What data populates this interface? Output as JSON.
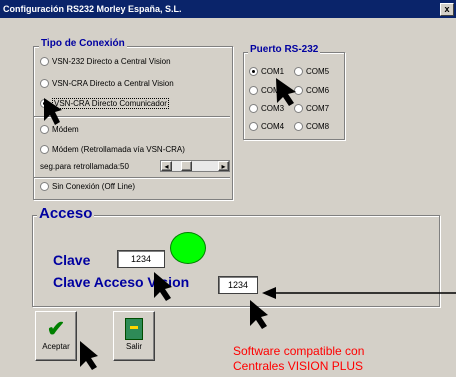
{
  "window": {
    "title": "Configuración RS232 Morley España, S.L.",
    "close": "x"
  },
  "tipo": {
    "legend": "Tipo de Conexión",
    "options": [
      "VSN-232 Directo a Central Vision",
      "VSN-CRA Directo a Central Vision",
      "VSN-CRA Directo Comunicador",
      "Módem",
      "Módem (Retrollamada vía VSN-CRA)",
      "Sin Conexión (Off Line)"
    ],
    "selected": 2,
    "retro_label": "seg.para retrollamada:50"
  },
  "puerto": {
    "legend": "Puerto RS-232",
    "ports": [
      "COM1",
      "COM5",
      "COM2",
      "COM6",
      "COM3",
      "COM7",
      "COM4",
      "COM8"
    ],
    "selected": "COM1"
  },
  "acceso": {
    "legend": "Acceso",
    "clave_label": "Clave",
    "clave_value": "1234",
    "clave_acceso_label": "Clave Acceso Vision",
    "clave_acceso_value": "1234",
    "status_color": "#00ff00"
  },
  "buttons": {
    "aceptar": "Aceptar",
    "salir": "Salir"
  },
  "footer": {
    "line1": "Software compatible con",
    "line2": "Centrales VISION PLUS"
  },
  "colors": {
    "title_bg": "#0a246a",
    "legend_blue": "#0000a0",
    "red_text": "#ff0000",
    "status_green": "#00ff00"
  }
}
